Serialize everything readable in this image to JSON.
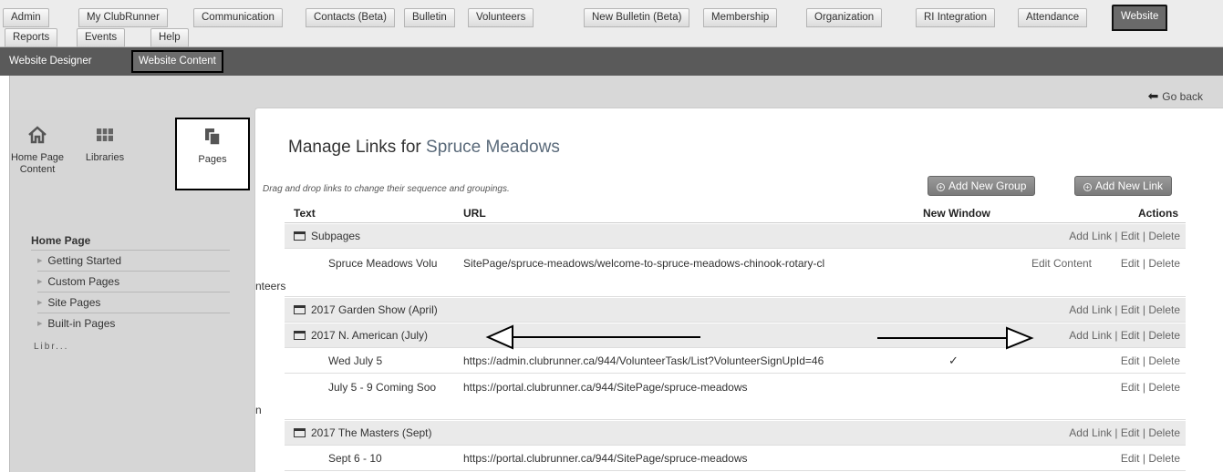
{
  "top_tabs": [
    "Admin",
    "My ClubRunner",
    "Communication",
    "Contacts (Beta)",
    "Bulletin",
    "Volunteers",
    "New Bulletin (Beta)",
    "Membership",
    "Organization",
    "RI Integration",
    "Attendance",
    "Website",
    "Reports",
    "Events",
    "Help"
  ],
  "sub_tabs": [
    "Website Designer",
    "Website Content"
  ],
  "go_back": "Go back",
  "left_icons": {
    "home": "Home Page Content",
    "libraries": "Libraries",
    "pages": "Pages"
  },
  "nav": {
    "section": "Home Page",
    "items": [
      "Getting Started",
      "Custom Pages",
      "Site Pages",
      "Built-in Pages"
    ],
    "more": "Libr..."
  },
  "page": {
    "title_prefix": "Manage Links for",
    "club_name": "Spruce Meadows",
    "hint": "Drag and drop links to change their sequence and groupings.",
    "add_group": "Add New Group",
    "add_link": "Add New Link"
  },
  "table": {
    "headers": {
      "text": "Text",
      "url": "URL",
      "new_window": "New Window",
      "actions": "Actions"
    },
    "group_actions": {
      "add_link": "Add Link",
      "edit": "Edit",
      "delete": "Delete",
      "sep": "|"
    },
    "link_actions": {
      "edit_content": "Edit Content",
      "edit": "Edit",
      "delete": "Delete"
    },
    "groups": [
      "Subpages",
      "2017 Garden Show (April)",
      "2017 N. American (July)",
      "2017 The Masters (Sept)"
    ],
    "links": [
      {
        "text": "Spruce Meadows Volu",
        "wrap": "nteers",
        "url": "SitePage/spruce-meadows/welcome-to-spruce-meadows-chinook-rotary-cl",
        "new_window": ""
      },
      {
        "text": "Wed July 5",
        "wrap": "",
        "url": "https://admin.clubrunner.ca/944/VolunteerTask/List?VolunteerSignUpId=46",
        "new_window": "✓"
      },
      {
        "text": "July 5 - 9 Coming Soo",
        "wrap": "n",
        "url": "https://portal.clubrunner.ca/944/SitePage/spruce-meadows",
        "new_window": ""
      },
      {
        "text": "Sept 6 - 10",
        "wrap": "",
        "url": "https://portal.clubrunner.ca/944/SitePage/spruce-meadows",
        "new_window": ""
      }
    ]
  },
  "icons": {
    "home": "home-icon",
    "libraries": "libraries-icon",
    "pages": "pages-icon",
    "folder": "folder-icon",
    "back": "back-arrow-icon",
    "check": "checkmark-icon"
  }
}
